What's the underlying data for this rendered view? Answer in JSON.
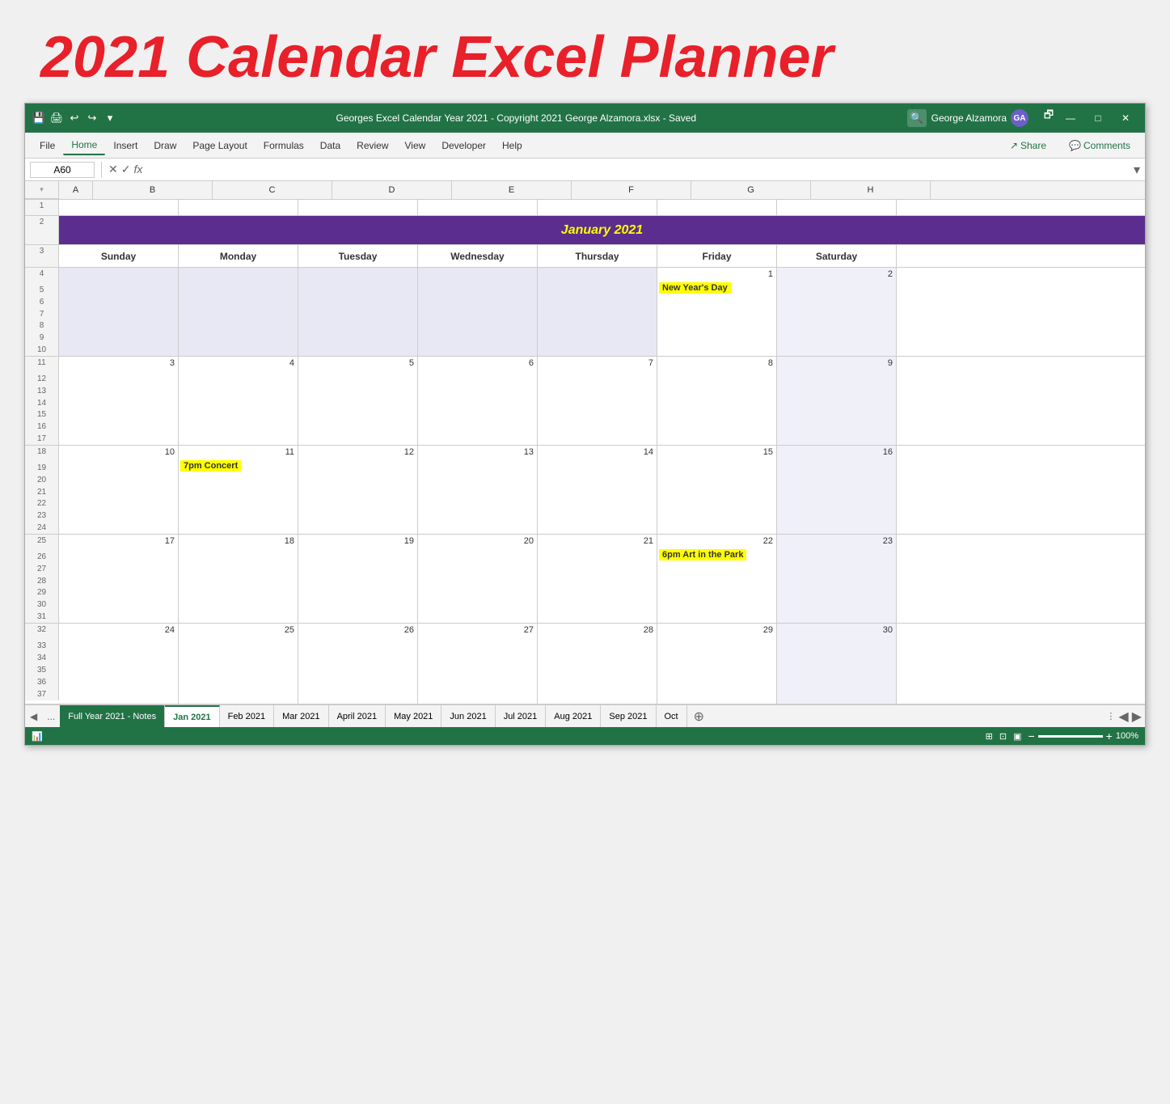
{
  "page_title": "2021 Calendar Excel Planner",
  "title_bar": {
    "filename": "Georges Excel Calendar Year 2021 - Copyright 2021 George Alzamora.xlsx  -  Saved",
    "user_name": "George Alzamora",
    "user_initials": "GA",
    "search_icon": "🔍",
    "restore_icon": "🗗",
    "minimize_icon": "—",
    "maximize_icon": "□",
    "close_icon": "✕"
  },
  "ribbon": {
    "tabs": [
      "File",
      "Home",
      "Insert",
      "Draw",
      "Page Layout",
      "Formulas",
      "Data",
      "Review",
      "View",
      "Developer",
      "Help"
    ],
    "active_tab": "Home",
    "share_label": "Share",
    "comments_label": "Comments"
  },
  "formula_bar": {
    "cell_ref": "A60",
    "formula_text": ""
  },
  "col_headers": [
    "A",
    "B",
    "C",
    "D",
    "E",
    "F",
    "G",
    "H"
  ],
  "row_numbers": [
    "1",
    "2",
    "3",
    "4",
    "5",
    "6",
    "7",
    "8",
    "9",
    "10",
    "11",
    "12",
    "13",
    "14",
    "15",
    "16",
    "17",
    "18",
    "19",
    "20",
    "21",
    "22",
    "23",
    "24",
    "25",
    "26",
    "27",
    "28",
    "29",
    "30",
    "31",
    "32",
    "33",
    "34",
    "35",
    "36",
    "37"
  ],
  "calendar": {
    "title": "January 2021",
    "title_bg": "#5b2d8e",
    "title_color": "#ffff00",
    "day_headers": [
      "Sunday",
      "Monday",
      "Tuesday",
      "Wednesday",
      "Thursday",
      "Friday",
      "Saturday"
    ],
    "weeks": [
      {
        "days": [
          {
            "num": "",
            "empty": true
          },
          {
            "num": "",
            "empty": true
          },
          {
            "num": "",
            "empty": true
          },
          {
            "num": "",
            "empty": true
          },
          {
            "num": "",
            "empty": true
          },
          {
            "num": "1",
            "event": "New Year's Day",
            "event_bg": "yellow"
          },
          {
            "num": "2",
            "weekend": true
          }
        ]
      },
      {
        "days": [
          {
            "num": "3"
          },
          {
            "num": "4"
          },
          {
            "num": "5"
          },
          {
            "num": "6"
          },
          {
            "num": "7"
          },
          {
            "num": "8"
          },
          {
            "num": "9",
            "weekend": true
          }
        ]
      },
      {
        "days": [
          {
            "num": "10"
          },
          {
            "num": "11",
            "event": "7pm Concert",
            "event_bg": "yellow"
          },
          {
            "num": "12"
          },
          {
            "num": "13"
          },
          {
            "num": "14"
          },
          {
            "num": "15"
          },
          {
            "num": "16",
            "weekend": true
          }
        ]
      },
      {
        "days": [
          {
            "num": "17"
          },
          {
            "num": "18"
          },
          {
            "num": "19"
          },
          {
            "num": "20"
          },
          {
            "num": "21"
          },
          {
            "num": "22",
            "event": "6pm Art in the Park",
            "event_bg": "yellow"
          },
          {
            "num": "23",
            "weekend": true
          }
        ]
      },
      {
        "days": [
          {
            "num": "24"
          },
          {
            "num": "25"
          },
          {
            "num": "26"
          },
          {
            "num": "27"
          },
          {
            "num": "28"
          },
          {
            "num": "29"
          },
          {
            "num": "30",
            "weekend": true
          }
        ]
      }
    ]
  },
  "sheet_tabs": [
    {
      "label": "...",
      "type": "nav"
    },
    {
      "label": "Full Year 2021 - Notes",
      "type": "green"
    },
    {
      "label": "Jan 2021",
      "type": "active"
    },
    {
      "label": "Feb 2021",
      "type": "normal"
    },
    {
      "label": "Mar 2021",
      "type": "normal"
    },
    {
      "label": "April 2021",
      "type": "normal"
    },
    {
      "label": "May 2021",
      "type": "normal"
    },
    {
      "label": "Jun 2021",
      "type": "normal"
    },
    {
      "label": "Jul 2021",
      "type": "normal"
    },
    {
      "label": "Aug 2021",
      "type": "normal"
    },
    {
      "label": "Sep 2021",
      "type": "normal"
    },
    {
      "label": "Oct",
      "type": "normal"
    }
  ],
  "status_bar": {
    "icon": "📊",
    "view_icons": [
      "⊞",
      "⊡",
      "▣"
    ],
    "zoom_minus": "−",
    "zoom_plus": "+",
    "zoom_level": "100%"
  }
}
